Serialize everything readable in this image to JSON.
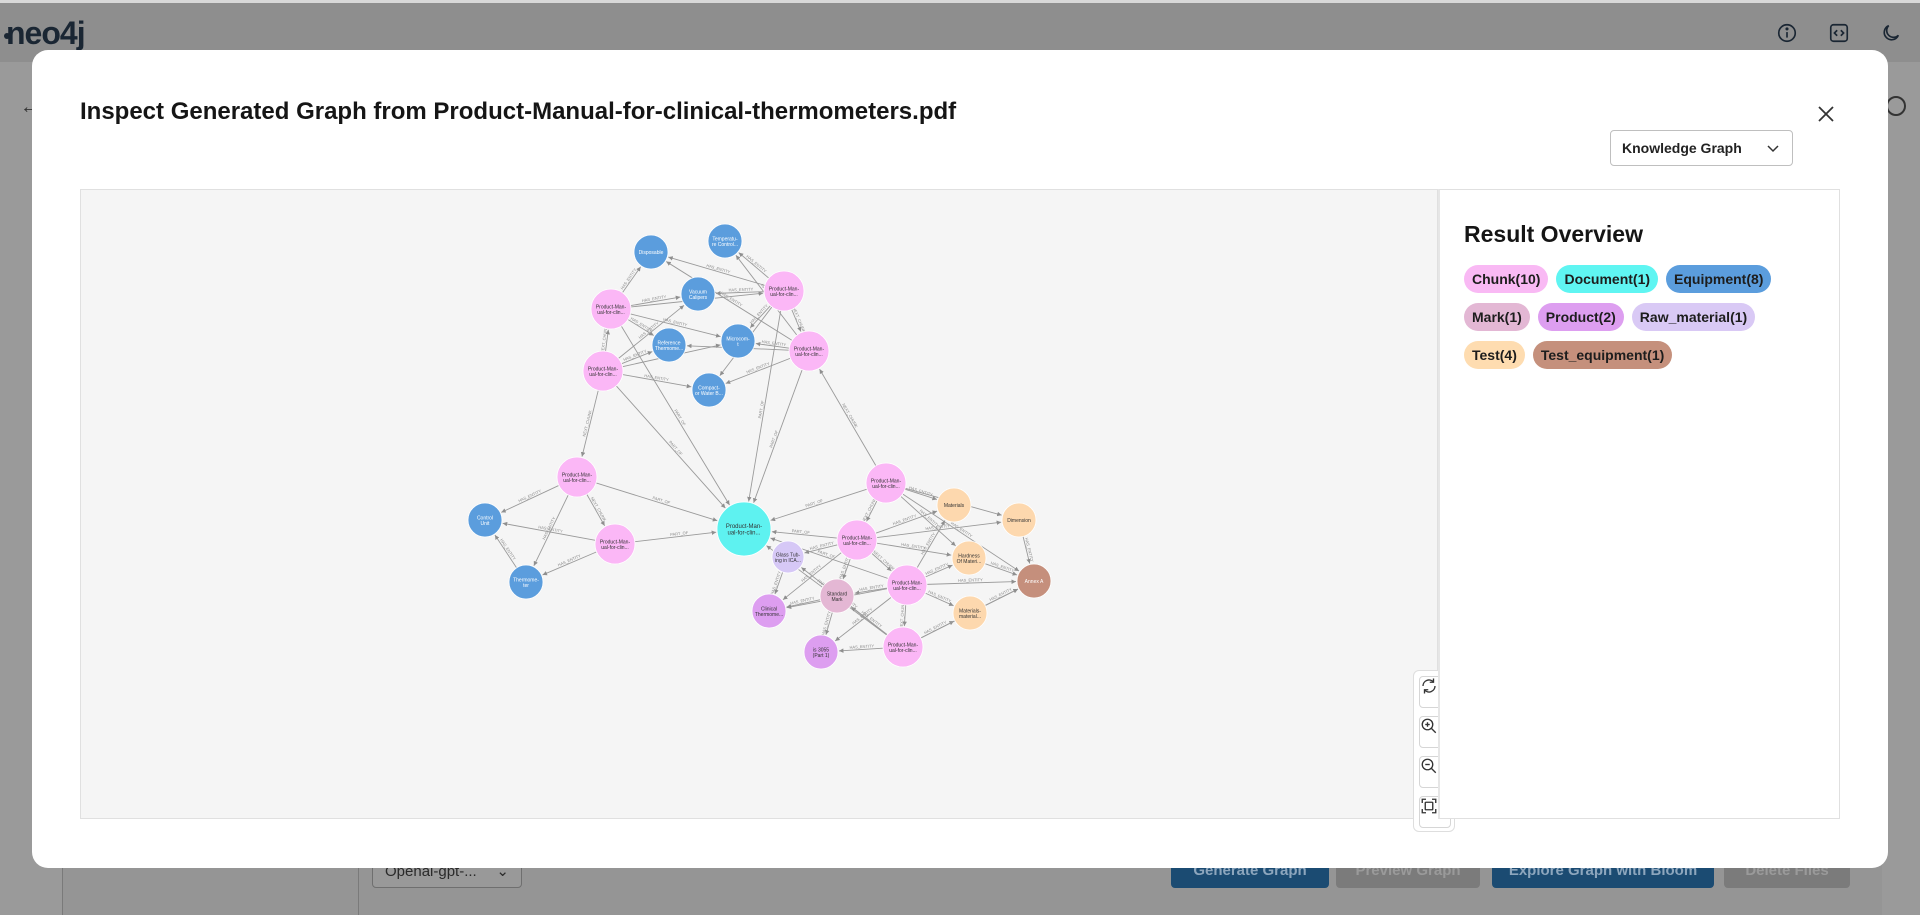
{
  "app": {
    "logo_text": "neo4j",
    "background": {
      "model_select": "Openai-gpt-...",
      "buttons": [
        "Generate Graph",
        "Preview Graph",
        "Explore Graph with Bloom",
        "Delete Files"
      ]
    }
  },
  "modal": {
    "title": "Inspect Generated Graph from Product-Manual-for-clinical-thermometers.pdf",
    "view_select": "Knowledge Graph",
    "result_overview_title": "Result Overview",
    "badges": [
      {
        "label": "Chunk(10)",
        "color": "#f9b9f4"
      },
      {
        "label": "Document(1)",
        "color": "#5ff5f2"
      },
      {
        "label": "Equipment(8)",
        "color": "#5b9ddd"
      },
      {
        "label": "Mark(1)",
        "color": "#e3b7d4"
      },
      {
        "label": "Product(2)",
        "color": "#dd9ef0"
      },
      {
        "label": "Raw_material(1)",
        "color": "#d9c9f5"
      },
      {
        "label": "Test(4)",
        "color": "#fedcb0"
      },
      {
        "label": "Test_equipment(1)",
        "color": "#c5907c"
      }
    ]
  },
  "graph": {
    "colors": {
      "chunk": "#fbb7f6",
      "document": "#5ef2f0",
      "equipment": "#5b9ddd",
      "mark": "#e4b7d4",
      "product": "#dd9ef0",
      "raw_material": "#d6c8f6",
      "test": "#fdd8ae",
      "test_equipment": "#c58f7c"
    },
    "nodes": [
      {
        "id": "d",
        "type": "document",
        "label": "Product-Man-\nual-for-clin..."
      },
      {
        "id": "e1",
        "type": "equipment",
        "label": "Disposable"
      },
      {
        "id": "e2",
        "type": "equipment",
        "label": "Temperatu-\nre Control..."
      },
      {
        "id": "e3",
        "type": "equipment",
        "label": "Vacuum\nCalipers"
      },
      {
        "id": "e4",
        "type": "equipment",
        "label": "Reference\nThermome..."
      },
      {
        "id": "e5",
        "type": "equipment",
        "label": "Microcom-\nt"
      },
      {
        "id": "e6",
        "type": "equipment",
        "label": "Compact-\nor Water B..."
      },
      {
        "id": "e7",
        "type": "equipment",
        "label": "Control\nUnit"
      },
      {
        "id": "e8",
        "type": "equipment",
        "label": "Thermome-\nter"
      },
      {
        "id": "c1",
        "type": "chunk",
        "label": "Product-Man-\nual-for-clin..."
      },
      {
        "id": "c2",
        "type": "chunk",
        "label": "Product-Man-\nual-for-clin..."
      },
      {
        "id": "c3",
        "type": "chunk",
        "label": "Product-Man-\nual-for-clin..."
      },
      {
        "id": "c4",
        "type": "chunk",
        "label": "Product-Man-\nual-for-clin..."
      },
      {
        "id": "c5",
        "type": "chunk",
        "label": "Product-Man-\nual-for-clin..."
      },
      {
        "id": "c6",
        "type": "chunk",
        "label": "Product-Man-\nual-for-clin..."
      },
      {
        "id": "c7",
        "type": "chunk",
        "label": "Product-Man-\nual-for-clin..."
      },
      {
        "id": "c8",
        "type": "chunk",
        "label": "Product-Man-\nual-for-clin..."
      },
      {
        "id": "c9",
        "type": "chunk",
        "label": "Product-Man-\nual-for-clin..."
      },
      {
        "id": "c10",
        "type": "chunk",
        "label": "Product-Man-\nual-for-clin..."
      },
      {
        "id": "t1",
        "type": "test",
        "label": "Materials"
      },
      {
        "id": "t2",
        "type": "test",
        "label": "Dimension"
      },
      {
        "id": "t3",
        "type": "test",
        "label": "Hardness\nOf Materi..."
      },
      {
        "id": "t4",
        "type": "test",
        "label": "Materials-\nmaterial..."
      },
      {
        "id": "te",
        "type": "test_equipment",
        "label": "Annex A"
      },
      {
        "id": "rm",
        "type": "raw_material",
        "label": "Glass Tub-\ning in ICA..."
      },
      {
        "id": "mk",
        "type": "mark",
        "label": "Standard\nMark"
      },
      {
        "id": "p1",
        "type": "product",
        "label": "Clinical\nThermome..."
      },
      {
        "id": "p2",
        "type": "product",
        "label": "is 3055\n(Part 1)"
      }
    ],
    "edges": [
      [
        "c1",
        "d",
        "PART_OF"
      ],
      [
        "c3",
        "d",
        "PART_OF"
      ],
      [
        "c4",
        "d",
        "PART_OF"
      ],
      [
        "c5",
        "d",
        "PART_OF"
      ],
      [
        "c6",
        "d",
        "PART_OF"
      ],
      [
        "c7",
        "d",
        "PART_OF"
      ],
      [
        "c8",
        "d",
        "PART_OF"
      ],
      [
        "c9",
        "d",
        "PART_OF"
      ],
      [
        "c10",
        "d",
        "PART_OF"
      ],
      [
        "c2",
        "d",
        "PART_OF"
      ],
      [
        "c1",
        "e1",
        "HAS_ENTITY"
      ],
      [
        "c1",
        "e3",
        "HAS_ENTITY"
      ],
      [
        "c1",
        "e4",
        "HAS_ENTITY"
      ],
      [
        "c1",
        "e5",
        "HAS_ENTITY"
      ],
      [
        "c2",
        "e1",
        "HAS_ENTITY"
      ],
      [
        "c2",
        "e2",
        "HAS_ENTITY"
      ],
      [
        "c2",
        "e3",
        "HAS_ENTITY"
      ],
      [
        "c2",
        "e5",
        "HAS_ENTITY"
      ],
      [
        "c2",
        "e6",
        "HAS_ENTITY"
      ],
      [
        "c3",
        "e2",
        "HAS_ENTITY"
      ],
      [
        "c3",
        "e4",
        "HAS_ENTITY"
      ],
      [
        "c3",
        "e5",
        "HAS_ENTITY"
      ],
      [
        "c3",
        "e6",
        "HAS_ENTITY"
      ],
      [
        "c3",
        "e1",
        "HAS_ENTITY"
      ],
      [
        "c4",
        "e4",
        "HAS_ENTITY"
      ],
      [
        "c4",
        "e5",
        "HAS_ENTITY"
      ],
      [
        "c4",
        "e6",
        "HAS_ENTITY"
      ],
      [
        "c4",
        "e3",
        "HAS_ENTITY"
      ],
      [
        "c4",
        "c1",
        "NEXT_CHUNK"
      ],
      [
        "c1",
        "c2",
        "NEXT_CHUNK"
      ],
      [
        "c2",
        "c3",
        "NEXT_CHUNK"
      ],
      [
        "c5",
        "e7",
        "HAS_ENTITY"
      ],
      [
        "c5",
        "e8",
        "HAS_ENTITY"
      ],
      [
        "c6",
        "e7",
        "HAS_ENTITY"
      ],
      [
        "c6",
        "e8",
        "HAS_ENTITY"
      ],
      [
        "c4",
        "c5",
        "NEXT_CHUNK"
      ],
      [
        "c5",
        "c6",
        "NEXT_CHUNK"
      ],
      [
        "e8",
        "e7",
        "HAS_ENTITY"
      ],
      [
        "c7",
        "t1",
        "HAS_ENTITY"
      ],
      [
        "c7",
        "t2",
        "HAS_ENTITY"
      ],
      [
        "c7",
        "t3",
        "HAS_ENTITY"
      ],
      [
        "c7",
        "te",
        "HAS_ENTITY"
      ],
      [
        "c8",
        "t1",
        "HAS_ENTITY"
      ],
      [
        "c8",
        "t3",
        "HAS_ENTITY"
      ],
      [
        "c8",
        "rm",
        "HAS_ENTITY"
      ],
      [
        "c8",
        "mk",
        "HAS_ENTITY"
      ],
      [
        "c8",
        "p1",
        "HAS_ENTITY"
      ],
      [
        "c9",
        "t3",
        "HAS_ENTITY"
      ],
      [
        "c9",
        "t4",
        "HAS_ENTITY"
      ],
      [
        "c9",
        "te",
        "HAS_ENTITY"
      ],
      [
        "c9",
        "mk",
        "HAS_ENTITY"
      ],
      [
        "c9",
        "p1",
        "HAS_ENTITY"
      ],
      [
        "c9",
        "t1",
        "HAS_ENTITY"
      ],
      [
        "c10",
        "t4",
        "HAS_ENTITY"
      ],
      [
        "c10",
        "p2",
        "HAS_ENTITY"
      ],
      [
        "c10",
        "mk",
        "HAS_ENTITY"
      ],
      [
        "c10",
        "te",
        "HAS_ENTITY"
      ],
      [
        "c10",
        "rm",
        "HAS_ENTITY"
      ],
      [
        "c7",
        "c8",
        "NEXT_CHUNK"
      ],
      [
        "c8",
        "c9",
        "NEXT_CHUNK"
      ],
      [
        "c9",
        "c10",
        "NEXT_CHUNK"
      ],
      [
        "c7",
        "c3",
        "NEXT_CHUNK"
      ],
      [
        "mk",
        "p1",
        "HAS_ENTITY"
      ],
      [
        "mk",
        "p2",
        "HAS_ENTITY"
      ],
      [
        "t2",
        "te",
        "HAS_ENTITY"
      ],
      [
        "t3",
        "te",
        "HAS_ENTITY"
      ],
      [
        "t4",
        "te",
        "HAS_ENTITY"
      ],
      [
        "rm",
        "p1",
        "HAS_ENTITY"
      ],
      [
        "c9",
        "p2",
        "HAS_ENTITY"
      ],
      [
        "c8",
        "t2",
        "HAS_ENTITY"
      ]
    ]
  }
}
